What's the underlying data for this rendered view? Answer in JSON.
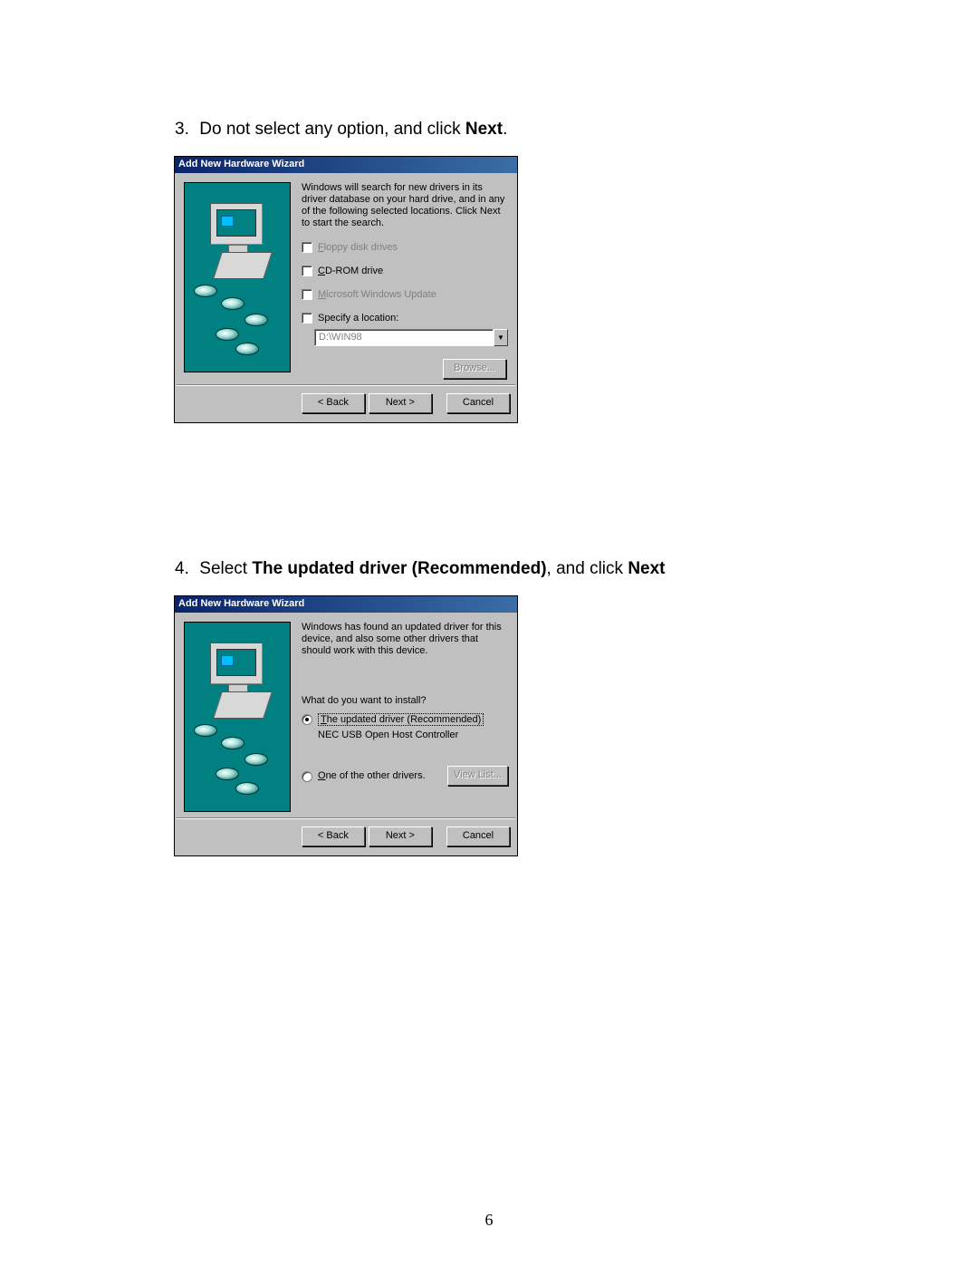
{
  "step3": {
    "num": "3.",
    "text_a": "Do not select any option, and click ",
    "text_b": "Next",
    "text_c": "."
  },
  "step4": {
    "num": "4.",
    "text_a": "Select ",
    "text_b": "The updated driver (Recommended)",
    "text_c": ", and click ",
    "text_d": "Next"
  },
  "wizard1": {
    "title": "Add New Hardware Wizard",
    "intro": "Windows will search for new drivers in its driver database on your hard drive, and in any of the following selected locations. Click Next to start the search.",
    "opt_floppy": "Floppy disk drives",
    "opt_cdrom": "CD-ROM drive",
    "opt_winupdate": "Microsoft Windows Update",
    "opt_specify": "Specify a location:",
    "loc_value": "D:\\WIN98",
    "browse": "Browse...",
    "back": "< Back",
    "next": "Next >",
    "cancel": "Cancel"
  },
  "wizard2": {
    "title": "Add New Hardware Wizard",
    "intro": "Windows has found an updated driver for this device, and also some other drivers that should work with this device.",
    "prompt": "What do you want to install?",
    "opt_updated": "The updated driver (Recommended)",
    "driver_name": "NEC USB Open Host Controller",
    "opt_other": "One of the other drivers.",
    "viewlist": "View List...",
    "back": "< Back",
    "next": "Next >",
    "cancel": "Cancel"
  },
  "page_number": "6"
}
